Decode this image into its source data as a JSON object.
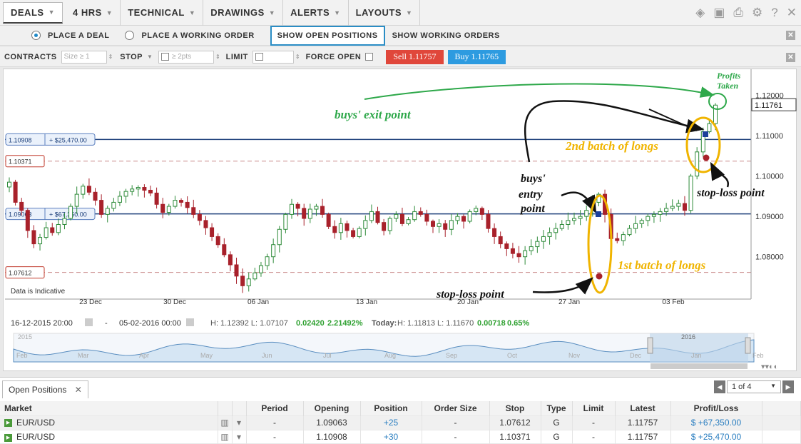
{
  "menu": [
    {
      "label": "DEALS",
      "active": true
    },
    {
      "label": "4 HRS"
    },
    {
      "label": "TECHNICAL"
    },
    {
      "label": "DRAWINGS"
    },
    {
      "label": "ALERTS"
    },
    {
      "label": "LAYOUTS"
    }
  ],
  "order_types": {
    "place_deal": "PLACE A DEAL",
    "place_working": "PLACE A WORKING ORDER",
    "show_open": "SHOW OPEN POSITIONS",
    "show_working": "SHOW WORKING ORDERS"
  },
  "ticket": {
    "contracts_label": "CONTRACTS",
    "contracts_placeholder": "Size ≥ 1",
    "stop_label": "STOP",
    "stop_placeholder": "≥ 2pts",
    "limit_label": "LIMIT",
    "force_open_label": "FORCE OPEN",
    "sell": "Sell 1.11757",
    "buy": "Buy 1.11765"
  },
  "chart_data": {
    "type": "candlestick",
    "instrument": "EUR/USD",
    "ylim": [
      1.0695,
      1.1265
    ],
    "y_ticks": [
      "1.12000",
      "1.11000",
      "1.10000",
      "1.09000",
      "1.08000"
    ],
    "y_tick_values": [
      1.12,
      1.11,
      1.1,
      1.09,
      1.08
    ],
    "x_ticks": [
      "23 Dec",
      "30 Dec",
      "06 Jan",
      "13 Jan",
      "20 Jan",
      "27 Jan",
      "03 Feb"
    ],
    "current_price": "1.11761",
    "levels": [
      {
        "label": "1.10908",
        "pl": "+ $25,470.00",
        "value": 1.10908,
        "style": "solid"
      },
      {
        "label": "1.10371",
        "value": 1.10371,
        "style": "dashed"
      },
      {
        "label": "1.09063",
        "pl": "+ $67,350.00",
        "value": 1.09063,
        "style": "solid"
      },
      {
        "label": "1.07612",
        "value": 1.07612,
        "style": "dashed"
      }
    ],
    "closes": [
      1.0985,
      1.0935,
      1.0915,
      1.0865,
      1.0832,
      1.0848,
      1.0872,
      1.086,
      1.088,
      1.0895,
      1.0925,
      1.0955,
      1.0975,
      1.096,
      1.094,
      1.0905,
      1.092,
      1.0935,
      1.095,
      1.0962,
      1.0968,
      1.0972,
      1.0965,
      1.0958,
      1.093,
      1.091,
      1.0925,
      1.094,
      1.0935,
      1.0922,
      1.0905,
      1.089,
      1.0872,
      1.085,
      1.083,
      1.0805,
      1.078,
      1.0752,
      1.0728,
      1.0745,
      1.076,
      1.0778,
      1.08,
      1.083,
      1.0868,
      1.0905,
      1.093,
      1.092,
      1.0895,
      1.0918,
      1.0925,
      1.0905,
      1.0875,
      1.086,
      1.0882,
      1.0865,
      1.085,
      1.087,
      1.089,
      1.0912,
      1.0885,
      1.0865,
      1.0895,
      1.0905,
      1.0882,
      1.0892,
      1.0912,
      1.0905,
      1.0888,
      1.0875,
      1.0882,
      1.0868,
      1.089,
      1.09,
      1.0888,
      1.0912,
      1.092,
      1.0905,
      1.087,
      1.085,
      1.0832,
      1.082,
      1.0808,
      1.08,
      1.0815,
      1.0825,
      1.0838,
      1.085,
      1.086,
      1.087,
      1.088,
      1.089,
      1.0895,
      1.09,
      1.0915,
      1.0935,
      1.0955,
      1.0905,
      1.0845,
      1.084,
      1.0855,
      1.087,
      1.0882,
      1.089,
      1.09,
      1.0905,
      1.0912,
      1.092,
      1.0925,
      1.0932,
      1.0915,
      1.1,
      1.106,
      1.111,
      1.113,
      1.1176
    ]
  },
  "annotations": {
    "profits_taken": "Profits Taken",
    "buys_exit": "buys' exit point",
    "second_batch": "2nd batch of longs",
    "buys_entry_1": "buys'",
    "buys_entry_2": "entry",
    "buys_entry_3": "point",
    "stop_loss_1": "stop-loss point",
    "first_batch": "1st batch of longs",
    "stop_loss_2": "stop-loss point",
    "indicative": "Data is Indicative"
  },
  "stats": {
    "start": "16-12-2015 20:00",
    "end": "05-02-2016 00:00",
    "hl": "H: 1.12392  L: 1.07107",
    "change": "0.02420",
    "pct": "2.21492%",
    "today": "Today:",
    "today_hl": "H: 1.11813  L: 1.11670",
    "today_change": "0.00718",
    "today_pct": "0.65%"
  },
  "navigator": {
    "months": [
      "Feb",
      "Mar",
      "Apr",
      "May",
      "Jun",
      "Jul",
      "Aug",
      "Sep",
      "Oct",
      "Nov",
      "Dec",
      "Jan",
      "Feb"
    ],
    "year": "2016",
    "year_left": "2015"
  },
  "positions": {
    "tab": "Open Positions",
    "page": "1 of 4",
    "headers": [
      "Market",
      "Period",
      "Opening",
      "Position",
      "Order Size",
      "Stop",
      "Type",
      "Limit",
      "Latest",
      "Profit/Loss"
    ],
    "rows": [
      {
        "market": "EUR/USD",
        "period": "-",
        "opening": "1.09063",
        "position": "+25",
        "order_size": "-",
        "stop": "1.07612",
        "type": "G",
        "limit": "-",
        "latest": "1.11757",
        "pl": "$ +67,350.00"
      },
      {
        "market": "EUR/USD",
        "period": "-",
        "opening": "1.10908",
        "position": "+30",
        "order_size": "-",
        "stop": "1.10371",
        "type": "G",
        "limit": "-",
        "latest": "1.11757",
        "pl": "$ +25,470.00"
      }
    ]
  },
  "colors": {
    "bull": "#2e8b3a",
    "bear": "#a8212b",
    "level_solid": "#1c3f7a",
    "level_dashed": "#c98b8b",
    "annot_green": "#2ea84a",
    "annot_yellow": "#f0b400"
  }
}
